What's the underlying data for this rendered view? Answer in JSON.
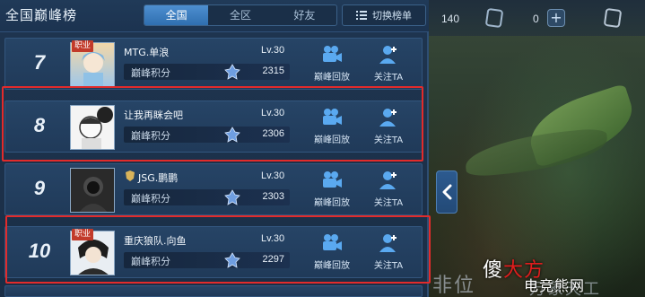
{
  "header": {
    "title": "全国巅峰榜",
    "tabs": [
      {
        "label": "全国",
        "active": true
      },
      {
        "label": "全区",
        "active": false
      },
      {
        "label": "好友",
        "active": false
      }
    ],
    "switch_label": "切换榜单"
  },
  "resources": {
    "count_a": "140",
    "count_b": "0"
  },
  "rows": [
    {
      "rank": "7",
      "name": "MTG.单浪",
      "level": "Lv.30",
      "score_label": "巅峰积分",
      "score": "2315",
      "badge": "职业",
      "replay_label": "巅峰回放",
      "follow_label": "关注TA"
    },
    {
      "rank": "8",
      "name": "让我再眯会吧",
      "level": "Lv.30",
      "score_label": "巅峰积分",
      "score": "2306",
      "badge": "",
      "replay_label": "巅峰回放",
      "follow_label": "关注TA"
    },
    {
      "rank": "9",
      "name": "JSG.鹏鹏",
      "level": "Lv.30",
      "score_label": "巅峰积分",
      "score": "2303",
      "badge": "",
      "replay_label": "巅峰回放",
      "follow_label": "关注TA"
    },
    {
      "rank": "10",
      "name": "重庆狼队.向鱼",
      "level": "Lv.30",
      "score_label": "巅峰积分",
      "score": "2297",
      "badge": "职业",
      "replay_label": "巅峰回放",
      "follow_label": "关注TA"
    }
  ],
  "scene": {
    "text_left": "非位",
    "text_right": "万象天工"
  },
  "watermark": {
    "part1": "傻",
    "part2": "大方",
    "part3": "电竞熊网"
  },
  "colors": {
    "highlight": "#e22b2b",
    "active_tab": "#3f80c2",
    "panel_bg": "#1f3550"
  }
}
